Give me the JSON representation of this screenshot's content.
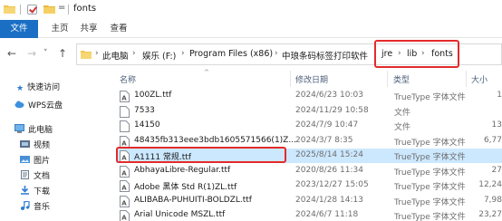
{
  "window": {
    "title": "fonts",
    "title_sep": "="
  },
  "ribbon": {
    "tabs": [
      "文件",
      "主页",
      "共享",
      "查看"
    ]
  },
  "address": {
    "crumbs": [
      "此电脑",
      "娱乐 (F:)",
      "Program Files (x86)",
      "中琅条码标签打印软件",
      "jre",
      "lib",
      "fonts"
    ]
  },
  "nav": {
    "items": [
      {
        "label": "快速访问",
        "icon": "star-icon"
      },
      {
        "label": "WPS云盘",
        "icon": "cloud-icon"
      },
      {
        "label": "此电脑",
        "icon": "computer-icon"
      },
      {
        "label": "视频",
        "icon": "video-icon"
      },
      {
        "label": "图片",
        "icon": "picture-icon"
      },
      {
        "label": "文档",
        "icon": "document-icon"
      },
      {
        "label": "下载",
        "icon": "download-icon"
      },
      {
        "label": "音乐",
        "icon": "music-icon"
      }
    ]
  },
  "list": {
    "columns": {
      "name": "名称",
      "date": "修改日期",
      "type": "类型",
      "size": "大小"
    },
    "rows": [
      {
        "name": "100ZL.ttf",
        "date": "2024/6/23 10:03",
        "type": "TrueType 字体文件",
        "size": "1",
        "icon": "font-file-icon",
        "selected": false
      },
      {
        "name": "7533",
        "date": "2024/11/29 10:58",
        "type": "文件",
        "size": "",
        "icon": "blank-file-icon",
        "selected": false
      },
      {
        "name": "14150",
        "date": "2024/7/9 10:47",
        "type": "文件",
        "size": "13",
        "icon": "blank-file-icon",
        "selected": false
      },
      {
        "name": "48435fb313eee3bdb1605571566(1)Z...",
        "date": "2024/3/7 8:35",
        "type": "TrueType 字体文件",
        "size": "6,77",
        "icon": "font-file-icon",
        "selected": false
      },
      {
        "name": "A1111 常规.ttf",
        "date": "2025/8/14 15:24",
        "type": "TrueType 字体文件",
        "size": "",
        "icon": "font-file-icon",
        "selected": true
      },
      {
        "name": "AbhayaLibre-Regular.ttf",
        "date": "2020/8/26 11:34",
        "type": "TrueType 字体文件",
        "size": "27",
        "icon": "font-file-icon",
        "selected": false
      },
      {
        "name": "Adobe 黑体 Std R(1)ZL.ttf",
        "date": "2023/12/27 15:05",
        "type": "TrueType 字体文件",
        "size": "12,24",
        "icon": "font-file-icon",
        "selected": false
      },
      {
        "name": "ALIBABA-PUHUITI-BOLDZL.ttf",
        "date": "2024/1/28 14:13",
        "type": "TrueType 字体文件",
        "size": "7,98",
        "icon": "font-file-icon",
        "selected": false
      },
      {
        "name": "Arial Unicode MSZL.ttf",
        "date": "2024/6/7 11:18",
        "type": "TrueType 字体文件",
        "size": "23,27",
        "icon": "font-file-icon",
        "selected": false
      }
    ]
  },
  "colors": {
    "accent": "#1a6fc4",
    "highlight": "#e32b2b",
    "selection": "#cce8ff"
  }
}
